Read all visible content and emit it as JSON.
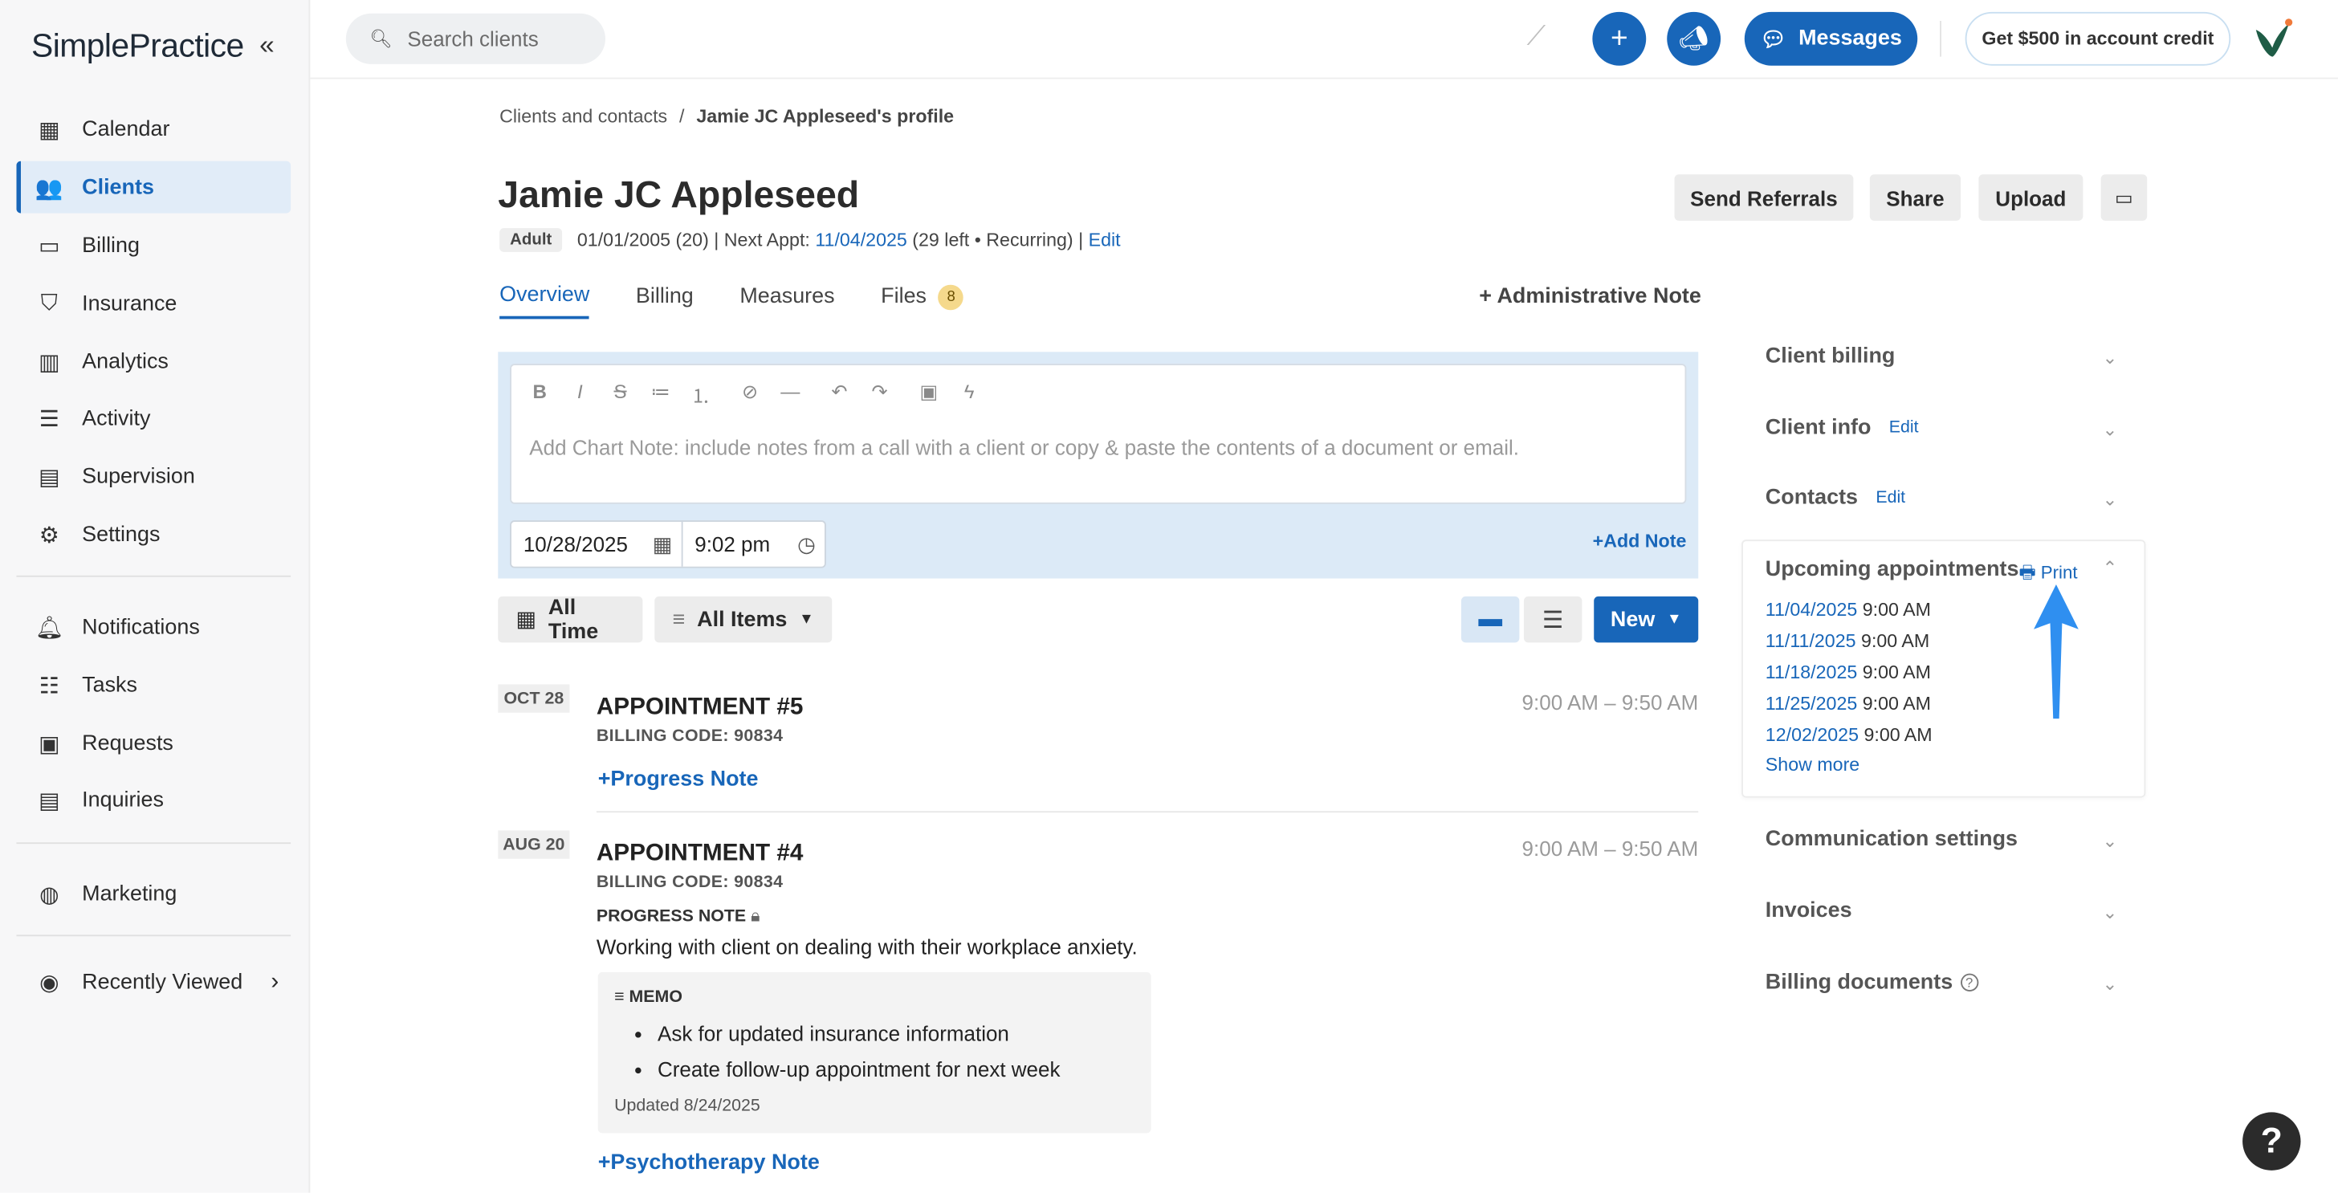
{
  "brand": {
    "logo_text": "SimplePractice",
    "collapse_icon": "double-chevron-left-icon"
  },
  "sidebar": {
    "items": [
      {
        "label": "Calendar",
        "icon": "calendar-icon"
      },
      {
        "label": "Clients",
        "icon": "clients-icon",
        "active": true
      },
      {
        "label": "Billing",
        "icon": "credit-card-icon"
      },
      {
        "label": "Insurance",
        "icon": "shield-icon"
      },
      {
        "label": "Analytics",
        "icon": "bar-chart-icon"
      },
      {
        "label": "Activity",
        "icon": "list-icon"
      },
      {
        "label": "Supervision",
        "icon": "supervision-icon"
      },
      {
        "label": "Settings",
        "icon": "gear-icon"
      },
      {
        "label": "Notifications",
        "icon": "bell-icon"
      },
      {
        "label": "Tasks",
        "icon": "checklist-icon"
      },
      {
        "label": "Requests",
        "icon": "calendar-request-icon"
      },
      {
        "label": "Inquiries",
        "icon": "inquiry-icon"
      },
      {
        "label": "Marketing",
        "icon": "globe-icon"
      },
      {
        "label": "Recently Viewed",
        "icon": "eye-icon"
      }
    ]
  },
  "topbar": {
    "search_placeholder": "Search clients",
    "messages_label": "Messages",
    "credit_label": "Get $500 in account credit"
  },
  "breadcrumb": {
    "parent": "Clients and contacts",
    "separator": "/",
    "current": "Jamie JC Appleseed's profile"
  },
  "client": {
    "name": "Jamie JC Appleseed",
    "badge": "Adult",
    "meta_prefix": "01/01/2005 (20) | Next Appt:",
    "next_appt": "11/04/2025",
    "meta_suffix": "(29 left • Recurring) |",
    "edit_label": "Edit"
  },
  "actions": {
    "send_referrals": "Send Referrals",
    "share": "Share",
    "upload": "Upload"
  },
  "tabs": [
    {
      "label": "Overview",
      "active": true
    },
    {
      "label": "Billing"
    },
    {
      "label": "Measures"
    },
    {
      "label": "Files",
      "count": "8"
    }
  ],
  "admin_note_label": "Administrative Note",
  "editor": {
    "placeholder": "Add Chart Note: include notes from a call with a client or copy & paste the contents of a document or email.",
    "date": "10/28/2025",
    "time": "9:02 pm",
    "add_note_label": "Add Note"
  },
  "filters": {
    "time_label": "All Time",
    "items_label": "All Items",
    "new_label": "New"
  },
  "timeline": [
    {
      "date": "OCT 28",
      "title": "APPOINTMENT #5",
      "billing_code": "BILLING CODE: 90834",
      "time": "9:00 AM – 9:50 AM",
      "add_label": "Progress Note"
    },
    {
      "date": "AUG 20",
      "title": "APPOINTMENT #4",
      "billing_code": "BILLING CODE: 90834",
      "time": "9:00 AM – 9:50 AM",
      "note_label": "PROGRESS NOTE",
      "note_text": "Working with client on dealing with their workplace anxiety.",
      "memo_label": "MEMO",
      "memo_items": [
        "Ask for updated insurance information",
        "Create follow-up appointment for next week"
      ],
      "memo_updated": "Updated 8/24/2025",
      "add_label": "Psychotherapy Note"
    }
  ],
  "right_panel": {
    "client_billing": "Client billing",
    "client_info": "Client info",
    "contacts": "Contacts",
    "edit_label": "Edit",
    "upcoming": "Upcoming appointments",
    "print_label": "Print",
    "appointments": [
      {
        "date": "11/04/2025",
        "time": "9:00 AM"
      },
      {
        "date": "11/11/2025",
        "time": "9:00 AM"
      },
      {
        "date": "11/18/2025",
        "time": "9:00 AM"
      },
      {
        "date": "11/25/2025",
        "time": "9:00 AM"
      },
      {
        "date": "12/02/2025",
        "time": "9:00 AM"
      }
    ],
    "show_more": "Show more",
    "communication": "Communication settings",
    "invoices": "Invoices",
    "billing_documents": "Billing documents"
  },
  "help_label": "?",
  "colors": {
    "accent": "#1866b9",
    "active_bg": "#e1ecf8",
    "annotation_arrow": "#2f8ff0"
  }
}
